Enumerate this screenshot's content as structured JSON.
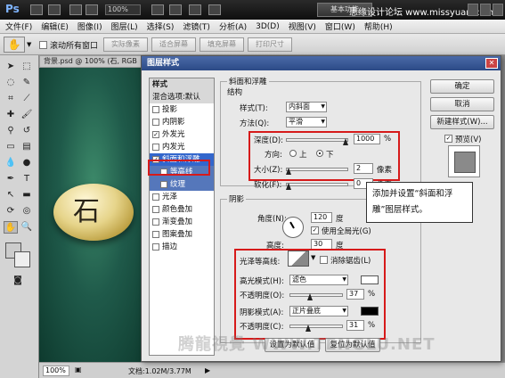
{
  "app": {
    "logo": "Ps",
    "zoom": "100%",
    "workspace": "基本功能",
    "watermark_top": "思缘设计论坛 www.missyuan.com"
  },
  "menu": [
    "文件(F)",
    "编辑(E)",
    "图像(I)",
    "图层(L)",
    "选择(S)",
    "滤镜(T)",
    "分析(A)",
    "3D(D)",
    "视图(V)",
    "窗口(W)",
    "帮助(H)"
  ],
  "options": {
    "scroll_all_windows": "滚动所有窗口",
    "actual_pixels": "实际像素",
    "fit_screen": "适合屏幕",
    "fill_screen": "填充屏幕",
    "print_size": "打印尺寸"
  },
  "document": {
    "tab": "背景.psd @ 100% (石, RGB",
    "stone_char": "石",
    "zoom_status": "100%",
    "doc_size": "文档:1.02M/3.77M"
  },
  "dialog": {
    "title": "图层样式",
    "styles_header": "样式",
    "blend_options": "混合选项:默认",
    "styles": [
      {
        "label": "投影",
        "checked": false
      },
      {
        "label": "内阴影",
        "checked": false
      },
      {
        "label": "外发光",
        "checked": true
      },
      {
        "label": "内发光",
        "checked": false
      },
      {
        "label": "斜面和浮雕",
        "checked": true,
        "selected": true
      },
      {
        "label": "等高线",
        "checked": false,
        "sub": true
      },
      {
        "label": "纹理",
        "checked": false,
        "sub": true
      },
      {
        "label": "光泽",
        "checked": false
      },
      {
        "label": "颜色叠加",
        "checked": false
      },
      {
        "label": "渐变叠加",
        "checked": false
      },
      {
        "label": "图案叠加",
        "checked": false
      },
      {
        "label": "描边",
        "checked": false
      }
    ],
    "bevel": {
      "group_title": "斜面和浮雕",
      "structure_title": "结构",
      "style_label": "样式(T):",
      "style_value": "内斜面",
      "technique_label": "方法(Q):",
      "technique_value": "平滑",
      "depth_label": "深度(D):",
      "depth_value": "1000",
      "depth_unit": "%",
      "direction_label": "方向:",
      "dir_up": "上",
      "dir_down": "下",
      "size_label": "大小(Z):",
      "size_value": "2",
      "size_unit": "像素",
      "soften_label": "软化(F):",
      "soften_value": "0",
      "soften_unit": "像素"
    },
    "shading": {
      "title": "阴影",
      "angle_label": "角度(N):",
      "angle_value": "120",
      "angle_unit": "度",
      "global_light": "使用全局光(G)",
      "altitude_label": "高度:",
      "altitude_value": "30",
      "altitude_unit": "度",
      "gloss_label": "光泽等高线:",
      "anti_alias": "消除锯齿(L)",
      "highlight_mode_label": "高光模式(H):",
      "highlight_mode": "滤色",
      "highlight_opacity_label": "不透明度(O):",
      "highlight_opacity": "37",
      "shadow_mode_label": "阴影模式(A):",
      "shadow_mode": "正片叠底",
      "shadow_opacity_label": "不透明度(C):",
      "shadow_opacity": "31",
      "percent": "%",
      "make_default": "设置为默认值",
      "reset_default": "复位为默认值"
    },
    "buttons": {
      "ok": "确定",
      "cancel": "取消",
      "new_style": "新建样式(W)...",
      "preview": "预览(V)"
    }
  },
  "callout": "添加并设置“斜面和浮雕”图层样式。",
  "watermark": "腾龍視覺 WWW.TENGLU.NET",
  "colors": {
    "highlight_swatch": "#ffffff",
    "shadow_swatch": "#000000",
    "accent_red": "#d61a1a",
    "selection_blue": "#3366cc"
  }
}
